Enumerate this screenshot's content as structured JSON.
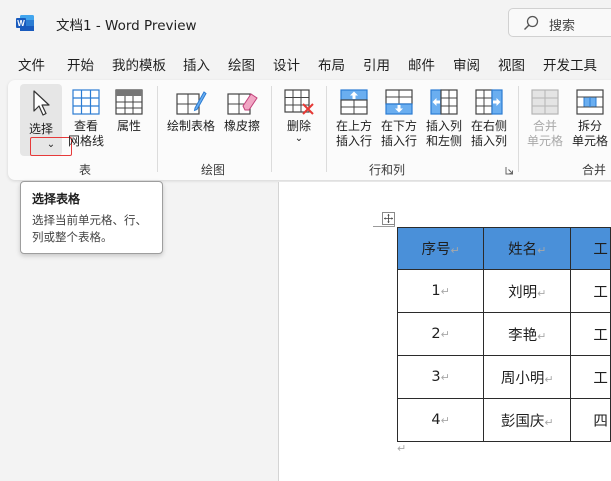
{
  "titlebar": {
    "title": "文档1  -  Word Preview",
    "search_label": "搜索"
  },
  "menu": [
    "文件",
    "开始",
    "我的模板",
    "插入",
    "绘图",
    "设计",
    "布局",
    "引用",
    "邮件",
    "审阅",
    "视图",
    "开发工具"
  ],
  "ribbon": {
    "select_label": "选择",
    "select_dropdown": "⌄",
    "gridlines_label": "查看\n网格线",
    "properties_label": "属性",
    "draw_table_label": "绘制表格",
    "eraser_label": "橡皮擦",
    "delete_label": "删除",
    "delete_dropdown": "⌄",
    "insert_above_label": "在上方\n插入行",
    "insert_below_label": "在下方\n插入行",
    "insert_left_label": "插入列\n和左侧",
    "insert_right_label": "在右侧\n插入列",
    "merge_cells_label": "合并\n单元格",
    "split_cells_label": "拆分\n单元格",
    "groups": {
      "table": "表",
      "draw": "绘图",
      "rows_cols": "行和列",
      "merge": "合并"
    }
  },
  "tooltip": {
    "title": "选择表格",
    "body": "选择当前单元格、行、列或整个表格。"
  },
  "table": {
    "paragraph_mark": "↵",
    "header": [
      "序号",
      "姓名",
      "工"
    ],
    "rows": [
      [
        "1",
        "刘明",
        "工"
      ],
      [
        "2",
        "李艳",
        "工"
      ],
      [
        "3",
        "周小明",
        "工"
      ],
      [
        "4",
        "彭国庆",
        "四"
      ]
    ]
  },
  "colors": {
    "accent_word": "#185abd",
    "table_header": "#4a90d9",
    "highlight_border": "#e63a3a"
  }
}
